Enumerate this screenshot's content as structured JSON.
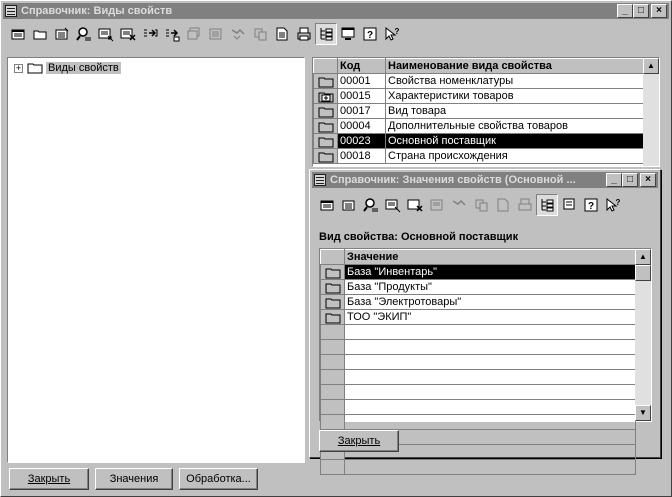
{
  "main_window": {
    "title": "Справочник: Виды свойств",
    "tree": {
      "root_label": "Виды свойств",
      "expander": "+"
    },
    "table": {
      "col_code": "Код",
      "col_name": "Наименование вида свойства",
      "rows": [
        {
          "icon": "folder-icon",
          "code": "00001",
          "name": "Свойства номенклатуры"
        },
        {
          "icon": "folder-plus-icon",
          "code": "00015",
          "name": "Характеристики товаров"
        },
        {
          "icon": "folder-icon",
          "code": "00017",
          "name": "Вид товара"
        },
        {
          "icon": "folder-icon",
          "code": "00004",
          "name": "Дополнительные свойства товаров"
        },
        {
          "icon": "folder-icon",
          "code": "00023",
          "name": "Основной поставщик"
        },
        {
          "icon": "folder-icon",
          "code": "00018",
          "name": "Страна происхождения"
        }
      ],
      "selected_row": 4
    },
    "buttons": {
      "close": "Закрыть",
      "values": "Значения",
      "process": "Обработка..."
    }
  },
  "child_window": {
    "title": "Справочник: Значения свойств (Основной ...",
    "caption_label": "Вид свойства:",
    "caption_value": "Основной поставщик",
    "table": {
      "col_value": "Значение",
      "rows": [
        {
          "icon": "folder-icon",
          "value": "База \"Инвентарь\""
        },
        {
          "icon": "folder-icon",
          "value": "База \"Продукты\""
        },
        {
          "icon": "folder-icon",
          "value": "База \"Электротовары\""
        },
        {
          "icon": "folder-icon",
          "value": "ТОО \"ЭКИП\""
        }
      ],
      "selected_row": 0,
      "empty_rows": 10
    },
    "buttons": {
      "close": "Закрыть"
    }
  },
  "window_controls": {
    "minimize": "_",
    "maximize": "□",
    "close": "×"
  },
  "colors": {
    "titlebar_inactive": "#808080",
    "face": "#c0c0c0",
    "selection": "#000000"
  }
}
